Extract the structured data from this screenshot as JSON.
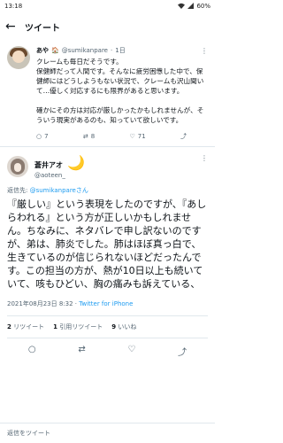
{
  "status": {
    "time": "13:18",
    "battery": "60%"
  },
  "header": {
    "title": "ツイート"
  },
  "tweet1": {
    "name": "あや",
    "handle": "@sumikanpare",
    "time": "1日",
    "body": "クレームも毎日だそうです。\n保健師だって人間です。そんなに疲労困憊した中で、保健師にはどうしようもない状況で、クレームも沢山聞いて…優しく対応するにも限界があると思います。\n\n確かにその方は対応が厳しかったかもしれませんが、そういう現実があるのも、知っていて欲しいです。",
    "replies": "7",
    "retweets": "8",
    "likes": "71"
  },
  "tweet2": {
    "name": "蒼井アオ",
    "handle": "@aoteen_",
    "reply_prefix": "返信先: ",
    "reply_handle": "@sumikanpareさん",
    "body": "『厳しい』という表現をしたのですが、『あしらわれる』という方が正しいかもしれません。ちなみに、ネタバレで申し訳ないのですが、弟は、肺炎でした。肺はほぼ真っ白で、生きているのが信じられないほどだったんです。この担当の方が、熱が10日以上も続いていて、咳もひどい、胸の痛みも訴えている、",
    "timestamp": "2021年08月23日 8:32 · ",
    "source": "Twitter for iPhone",
    "retweets_count": "2",
    "retweets_label": "リツイート",
    "quotes_count": "1",
    "quotes_label": "引用リツイート",
    "likes_count": "9",
    "likes_label": "いいね"
  },
  "compose": {
    "placeholder": "返信をツイート"
  }
}
